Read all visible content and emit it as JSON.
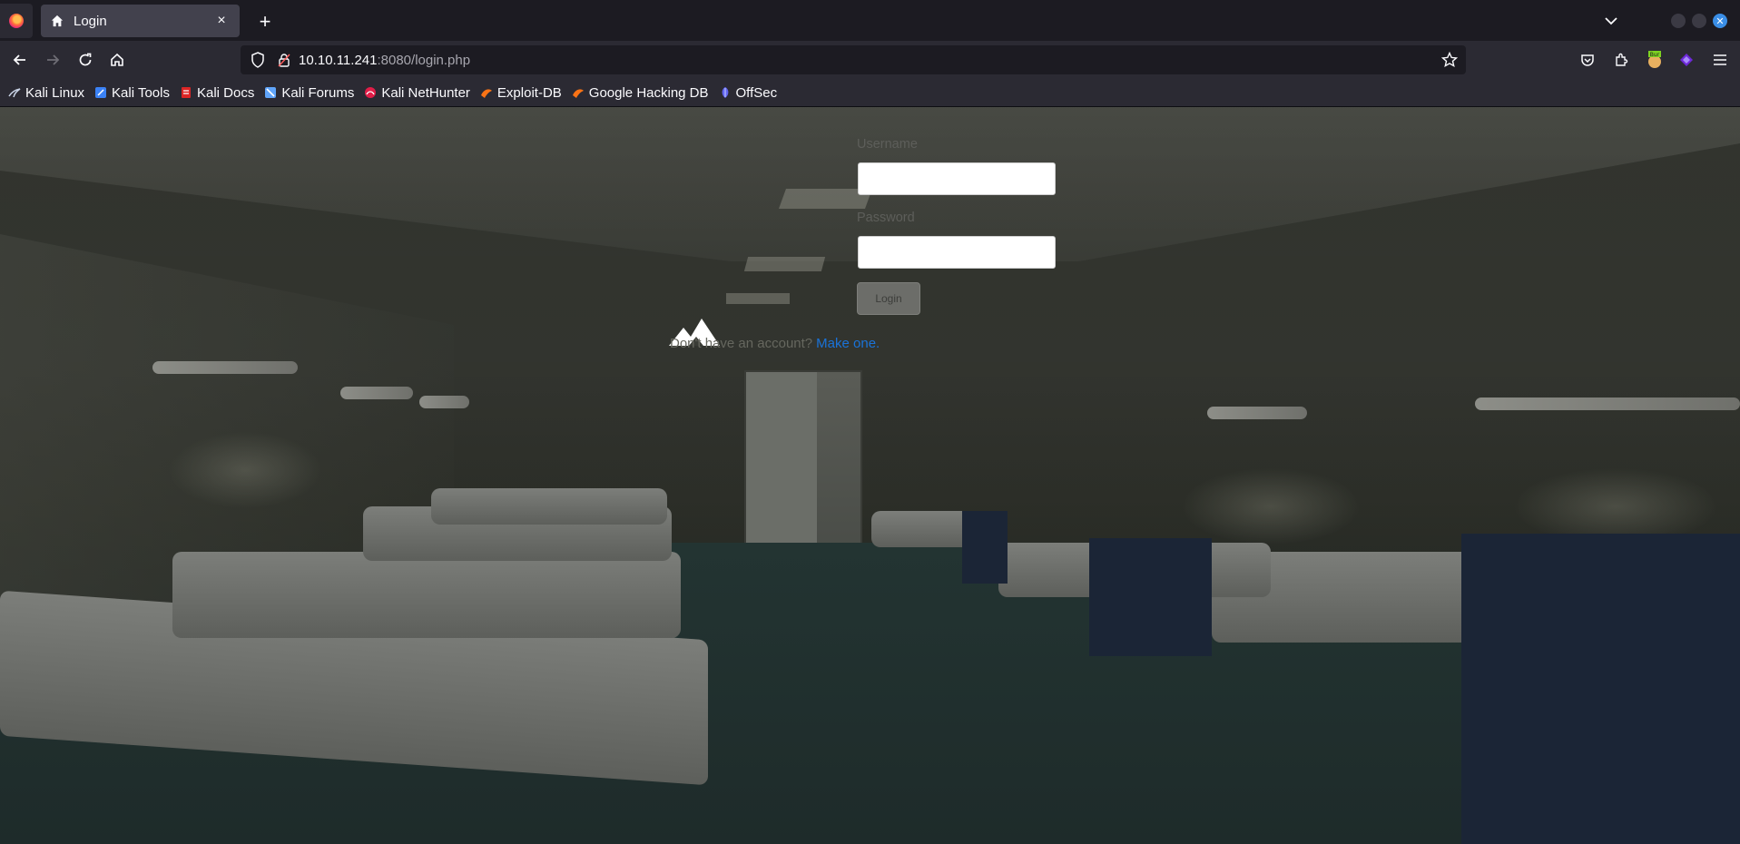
{
  "browser": {
    "tab": {
      "title": "Login",
      "icon": "home-icon",
      "close": "×"
    },
    "new_tab": "+",
    "address": {
      "host": "10.10.11.241",
      "rest": ":8080/login.php"
    },
    "bookmarks": [
      {
        "label": "Kali Linux",
        "icon": "kali-icon",
        "color": "#1c1b22"
      },
      {
        "label": "Kali Tools",
        "icon": "kali-tools-icon",
        "color": "#3b82f6"
      },
      {
        "label": "Kali Docs",
        "icon": "kali-docs-icon",
        "color": "#dc2626"
      },
      {
        "label": "Kali Forums",
        "icon": "kali-forums-icon",
        "color": "#60a5fa"
      },
      {
        "label": "Kali NetHunter",
        "icon": "nethunter-icon",
        "color": "#e11d48"
      },
      {
        "label": "Exploit-DB",
        "icon": "exploit-db-icon",
        "color": "#f97316"
      },
      {
        "label": "Google Hacking DB",
        "icon": "ghdb-icon",
        "color": "#f97316"
      },
      {
        "label": "OffSec",
        "icon": "offsec-icon",
        "color": "#6366f1"
      }
    ],
    "toolbar_icons": [
      "pocket-icon",
      "extensions-icon",
      "burp-icon",
      "extension-purple-icon",
      "menu-icon"
    ]
  },
  "page": {
    "username_label": "Username",
    "password_label": "Password",
    "login_button": "Login",
    "signup_text": "Don't have an account?",
    "signup_link": "Make one.",
    "colors": {
      "link": "#1a73d9",
      "label": "#5d5e5a",
      "button": "#6c6d69"
    }
  }
}
